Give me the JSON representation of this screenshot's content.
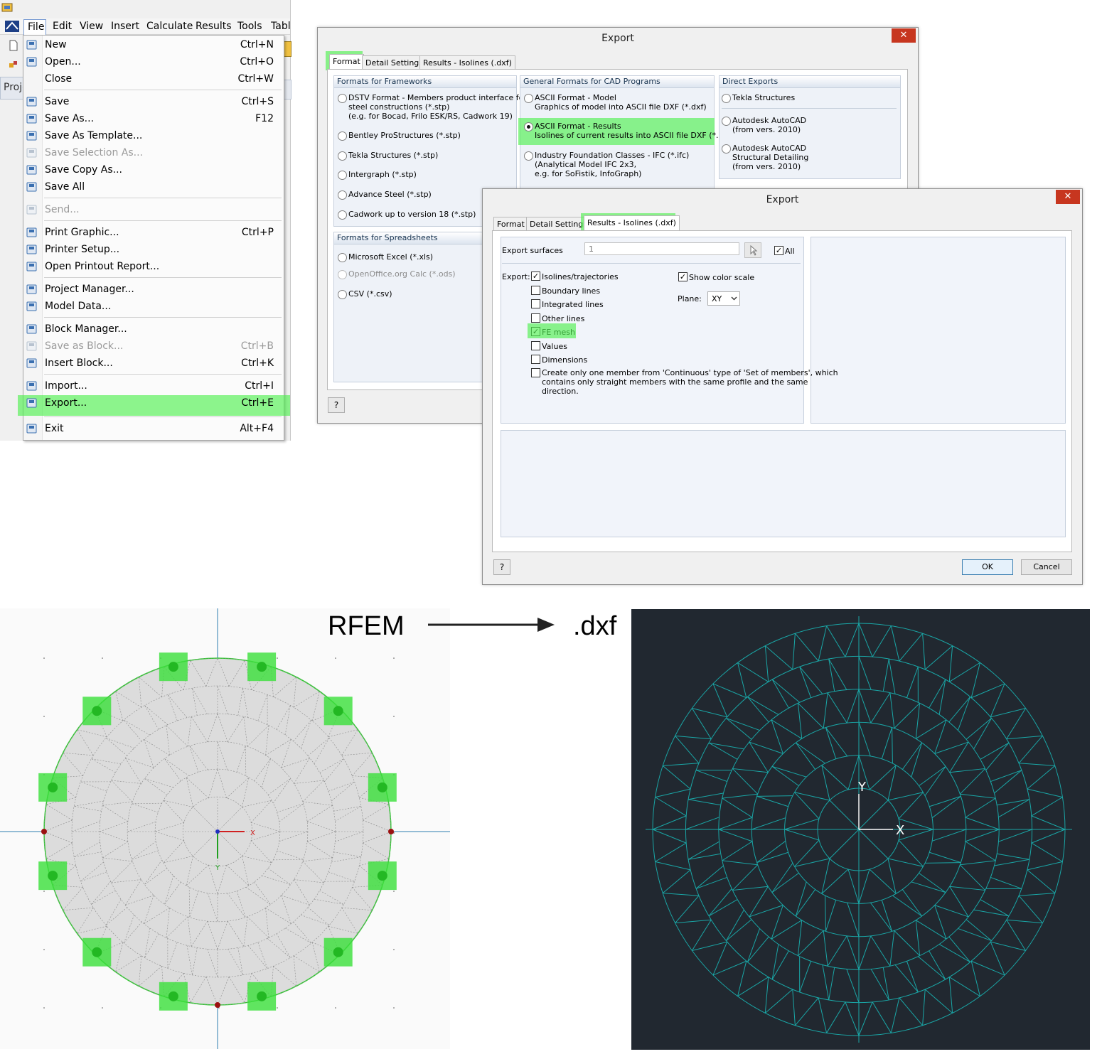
{
  "menubar": {
    "items": [
      "File",
      "Edit",
      "View",
      "Insert",
      "Calculate",
      "Results",
      "Tools",
      "Table"
    ],
    "project_tab": "Proje"
  },
  "file_menu": {
    "items": [
      {
        "label": "New",
        "shortcut": "Ctrl+N",
        "icon": "new-document-icon",
        "enabled": true
      },
      {
        "label": "Open...",
        "shortcut": "Ctrl+O",
        "icon": "open-folder-icon",
        "enabled": true
      },
      {
        "label": "Close",
        "shortcut": "Ctrl+W",
        "icon": "",
        "enabled": true
      },
      {
        "label": "Save",
        "shortcut": "Ctrl+S",
        "icon": "save-icon",
        "enabled": true
      },
      {
        "label": "Save As...",
        "shortcut": "F12",
        "icon": "save-as-icon",
        "enabled": true
      },
      {
        "label": "Save As Template...",
        "shortcut": "",
        "icon": "save-template-icon",
        "enabled": true
      },
      {
        "label": "Save Selection As...",
        "shortcut": "",
        "icon": "save-selection-icon",
        "enabled": false
      },
      {
        "label": "Save Copy As...",
        "shortcut": "",
        "icon": "save-copy-icon",
        "enabled": true
      },
      {
        "label": "Save All",
        "shortcut": "",
        "icon": "save-all-icon",
        "enabled": true
      },
      {
        "label": "Send...",
        "shortcut": "",
        "icon": "send-icon",
        "enabled": false
      },
      {
        "label": "Print Graphic...",
        "shortcut": "Ctrl+P",
        "icon": "print-graphic-icon",
        "enabled": true
      },
      {
        "label": "Printer Setup...",
        "shortcut": "",
        "icon": "printer-setup-icon",
        "enabled": true
      },
      {
        "label": "Open Printout Report...",
        "shortcut": "",
        "icon": "printout-report-icon",
        "enabled": true
      },
      {
        "label": "Project Manager...",
        "shortcut": "",
        "icon": "project-manager-icon",
        "enabled": true
      },
      {
        "label": "Model Data...",
        "shortcut": "",
        "icon": "model-data-icon",
        "enabled": true
      },
      {
        "label": "Block Manager...",
        "shortcut": "",
        "icon": "block-manager-icon",
        "enabled": true
      },
      {
        "label": "Save as Block...",
        "shortcut": "Ctrl+B",
        "icon": "save-block-icon",
        "enabled": false
      },
      {
        "label": "Insert Block...",
        "shortcut": "Ctrl+K",
        "icon": "insert-block-icon",
        "enabled": true
      },
      {
        "label": "Import...",
        "shortcut": "Ctrl+I",
        "icon": "import-icon",
        "enabled": true
      },
      {
        "label": "Export...",
        "shortcut": "Ctrl+E",
        "icon": "export-icon",
        "enabled": true
      },
      {
        "label": "Exit",
        "shortcut": "Alt+F4",
        "icon": "exit-icon",
        "enabled": true
      }
    ]
  },
  "export_dialog_1": {
    "title": "Export",
    "close": "✕",
    "tabs": [
      "Format",
      "Detail Settings",
      "Results - Isolines (.dxf)"
    ],
    "frameworks": {
      "header": "Formats for Frameworks",
      "options": [
        [
          "DSTV Format - Members product interface for",
          "steel constructions (*.stp)",
          "(e.g. for Bocad, Frilo ESK/RS, Cadwork 19)"
        ],
        [
          "Bentley ProStructures (*.stp)"
        ],
        [
          "Tekla Structures (*.stp)"
        ],
        [
          "Intergraph (*.stp)"
        ],
        [
          "Advance Steel (*.stp)"
        ],
        [
          "Cadwork up to version 18 (*.stp)"
        ]
      ]
    },
    "spreadsheets": {
      "header": "Formats for Spreadsheets",
      "options": [
        "Microsoft Excel (*.xls)",
        "OpenOffice.org Calc (*.ods)",
        "CSV (*.csv)"
      ]
    },
    "cad": {
      "header": "General Formats for CAD Programs",
      "options": [
        [
          "ASCII Format - Model",
          "Graphics of model into ASCII file DXF (*.dxf)"
        ],
        [
          "ASCII Format - Results",
          "Isolines of current results into ASCII file DXF (*.dxf)"
        ],
        [
          "Industry Foundation Classes - IFC (*.ifc)",
          "(Analytical Model IFC 2x3,",
          "e.g. for SoFistik, InfoGraph)"
        ]
      ]
    },
    "direct": {
      "header": "Direct Exports",
      "options": [
        [
          "Tekla Structures"
        ],
        [
          "Autodesk AutoCAD",
          "(from vers. 2010)"
        ],
        [
          "Autodesk AutoCAD",
          "Structural Detailing",
          "(from vers. 2010)"
        ]
      ]
    },
    "help": "?"
  },
  "export_dialog_2": {
    "title": "Export",
    "close": "✕",
    "tabs": [
      "Format",
      "Detail Settings",
      "Results - Isolines (.dxf)"
    ],
    "surfaces_label": "Export surfaces",
    "surfaces_value": "1",
    "all_label": "All",
    "export_label": "Export:",
    "checks": [
      {
        "label": "Isolines/trajectories",
        "checked": true
      },
      {
        "label": "Boundary lines",
        "checked": false
      },
      {
        "label": "Integrated lines",
        "checked": false
      },
      {
        "label": "Other lines",
        "checked": false
      },
      {
        "label": "FE mesh",
        "checked": true
      },
      {
        "label": "Values",
        "checked": false
      },
      {
        "label": "Dimensions",
        "checked": false
      }
    ],
    "create_member": [
      "Create only one member from 'Continuous' type of 'Set of members', which",
      "contains only straight members with the same profile and the same",
      "direction."
    ],
    "color_scale": "Show color scale",
    "plane_label": "Plane:",
    "plane_value": "XY",
    "ok": "OK",
    "cancel": "Cancel",
    "help": "?"
  },
  "bottom": {
    "rfem_label": "RFEM",
    "dxf_label": ".dxf",
    "rfem_axis_x": "X",
    "rfem_axis_y": "Y",
    "dxf_axis_x": "X",
    "dxf_axis_y": "Y"
  },
  "colors": {
    "highlight": "#50f050",
    "dxf_background": "#212830",
    "dxf_mesh": "#1aa6a6",
    "support": "#3ae03a",
    "plate_fill": "#dcdcdc"
  }
}
